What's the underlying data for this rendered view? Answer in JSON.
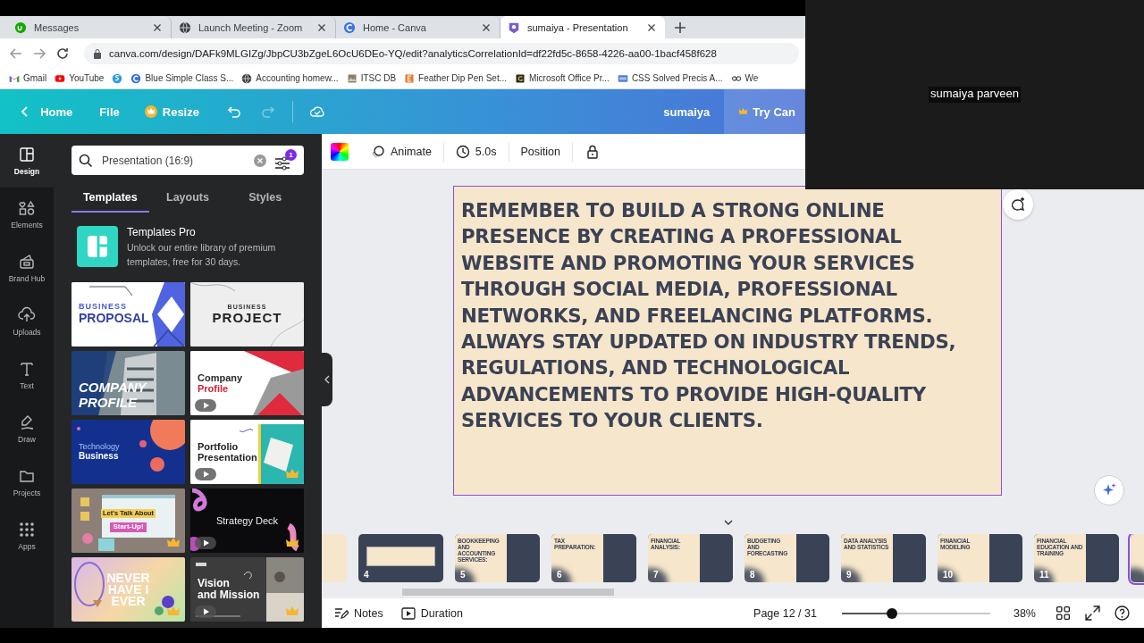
{
  "browser": {
    "tabs": [
      {
        "title": "Messages",
        "selected": false
      },
      {
        "title": "Launch Meeting - Zoom",
        "selected": false
      },
      {
        "title": "Home - Canva",
        "selected": false
      },
      {
        "title": "sumaiya - Presentation",
        "selected": true
      }
    ],
    "address": "canva.com/design/DAFk9MLGIZg/JbpCU3bZgeL6OcU6DEo-YQ/edit?analyticsCorrelationId=df22fd5c-8658-4226-aa00-1bacf458f628",
    "bookmarks": [
      {
        "label": "Gmail"
      },
      {
        "label": "YouTube"
      },
      {
        "kind": "icon"
      },
      {
        "label": "Blue Simple Class S..."
      },
      {
        "label": "Accounting homew..."
      },
      {
        "label": "ITSC DB"
      },
      {
        "label": "Feather Dip Pen Set..."
      },
      {
        "label": "Microsoft Office Pr..."
      },
      {
        "label": "CSS Solved Precis A..."
      },
      {
        "label": "We"
      }
    ]
  },
  "header": {
    "home": "Home",
    "file": "File",
    "resize": "Resize",
    "redo_disabled": true,
    "user": "sumaiya",
    "trial": "Try Can"
  },
  "rail": [
    {
      "label": "Design",
      "selected": true
    },
    {
      "label": "Elements",
      "selected": false
    },
    {
      "label": "Brand Hub",
      "selected": false
    },
    {
      "label": "Uploads",
      "selected": false
    },
    {
      "label": "Text",
      "selected": false
    },
    {
      "label": "Draw",
      "selected": false
    },
    {
      "label": "Projects",
      "selected": false
    },
    {
      "label": "Apps",
      "selected": false
    }
  ],
  "panel": {
    "search": "Presentation (16:9)",
    "filter_count": "1",
    "tabs": [
      {
        "label": "Templates",
        "selected": true
      },
      {
        "label": "Layouts",
        "selected": false
      },
      {
        "label": "Styles",
        "selected": false
      }
    ],
    "promo": {
      "title": "Templates Pro",
      "text": "Unlock our entire library of premium templates, free for 30 days."
    },
    "templates": [
      {
        "kind": "proposal",
        "lines": [
          "BUSINESS",
          "PROPOSAL"
        ],
        "play": false,
        "pro": false
      },
      {
        "kind": "project",
        "lines": [
          "BUSINESS",
          "PROJECT"
        ],
        "play": false,
        "pro": false
      },
      {
        "kind": "company_dark",
        "lines": [
          "COMPANY",
          "PROFILE"
        ],
        "play": false,
        "pro": false
      },
      {
        "kind": "company_red",
        "lines": [
          "Company",
          "Profile"
        ],
        "play": true,
        "pro": false
      },
      {
        "kind": "tech",
        "lines": [
          "Technology",
          "Business"
        ],
        "play": false,
        "pro": false
      },
      {
        "kind": "portfolio",
        "lines": [
          "Portfolio",
          "Presentation"
        ],
        "play": true,
        "pro": true
      },
      {
        "kind": "talk",
        "lines": [
          "Let's Talk About",
          "Start-Up!"
        ],
        "play": false,
        "pro": true
      },
      {
        "kind": "strategy",
        "lines": [
          "Strategy Deck"
        ],
        "play": true,
        "pro": true
      },
      {
        "kind": "never",
        "lines": [
          "NEVER",
          "HAVE I",
          "EVER"
        ],
        "play": false,
        "pro": true
      },
      {
        "kind": "vision",
        "lines": [
          "Vision",
          "and Mission"
        ],
        "play": true,
        "pro": true
      }
    ]
  },
  "toolbar": {
    "animate": "Animate",
    "duration": "5.0s",
    "position": "Position"
  },
  "slide": {
    "text": "REMEMBER TO BUILD A STRONG ONLINE PRESENCE BY CREATING A PROFESSIONAL WEBSITE AND PROMOTING YOUR SERVICES THROUGH SOCIAL MEDIA, PROFESSIONAL NETWORKS, AND FREELANCING PLATFORMS. ALWAYS STAY UPDATED ON INDUSTRY TRENDS, REGULATIONS, AND TECHNOLOGICAL ADVANCEMENTS TO PROVIDE HIGH-QUALITY SERVICES TO YOUR CLIENTS."
  },
  "pages": [
    {
      "kind": "cream",
      "selected": false
    },
    {
      "kind": "box",
      "number": "4",
      "selected": false
    },
    {
      "kind": "split",
      "number": "5",
      "title": "BOOKKEEPING AND ACCOUNTING SERVICES:",
      "selected": false
    },
    {
      "kind": "split",
      "number": "6",
      "title": "TAX PREPARATION:",
      "selected": false
    },
    {
      "kind": "split",
      "number": "7",
      "title": "FINANCIAL ANALYSIS:",
      "selected": false
    },
    {
      "kind": "split",
      "number": "8",
      "title": "BUDGETING AND FORECASTING",
      "selected": false
    },
    {
      "kind": "split",
      "number": "9",
      "title": "DATA ANALYSIS AND STATISTICS",
      "selected": false
    },
    {
      "kind": "split",
      "number": "10",
      "title": "FINANCIAL MODELING",
      "selected": false
    },
    {
      "kind": "split",
      "number": "11",
      "title": "FINANCIAL EDUCATION AND TRAINING",
      "selected": false
    },
    {
      "kind": "split",
      "selected": true
    }
  ],
  "footer": {
    "notes": "Notes",
    "duration": "Duration",
    "page": "Page 12 / 31",
    "zoom": {
      "level": 0.34,
      "reading": "38%"
    }
  },
  "meeting": {
    "name": "sumaiya parveen"
  }
}
